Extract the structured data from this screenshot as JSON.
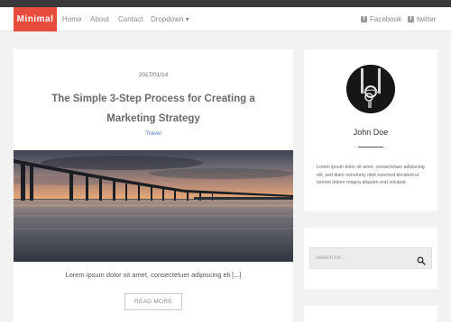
{
  "nav": {
    "brand": "Minimal",
    "items": [
      {
        "label": "Home"
      },
      {
        "label": "About"
      },
      {
        "label": "Contact"
      },
      {
        "label": "Dropdown ▾"
      }
    ],
    "social": [
      {
        "label": "Facebook",
        "icon": "facebook-icon"
      },
      {
        "label": "twitter",
        "icon": "twitter-icon"
      }
    ]
  },
  "post": {
    "date": "2017/01/14",
    "title": "The Simple 3-Step Process for Creating a Marketing Strategy",
    "category": "Travel",
    "image": "pier-sunset-image",
    "excerpt": "Lorem ipsum dolor sit amet, consectetuer adipiscing eli [...]",
    "read_more": "READ MORE"
  },
  "author": {
    "name": "John Doe",
    "bio": "Lorem ipsum dolor sit amet, consectetuer adipiscing elit, sed diam nonummy nibh euismod tincidunt ut laoreet dolore magna aliquam erat volutpat."
  },
  "search": {
    "placeholder": "Search for..."
  },
  "colors": {
    "brand": "#e74c3c",
    "link": "#4a7fbf"
  }
}
